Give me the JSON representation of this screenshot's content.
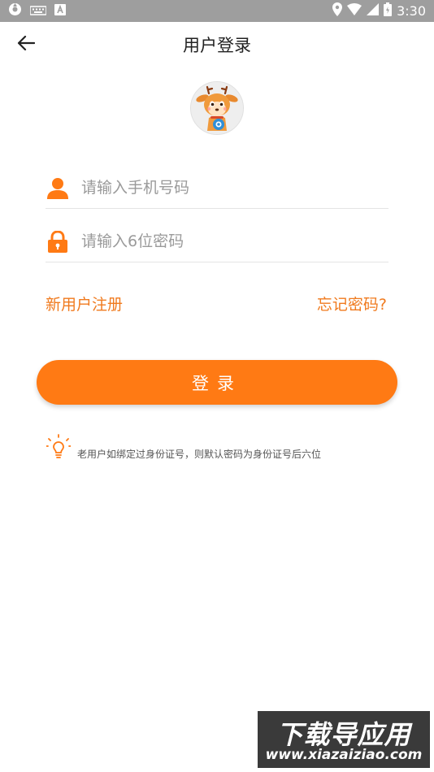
{
  "status_bar": {
    "time": "3:30",
    "icons": [
      "sync-icon",
      "keyboard-icon",
      "text-a-icon",
      "location-icon",
      "wifi-icon",
      "signal-icon",
      "battery-icon"
    ]
  },
  "header": {
    "back_icon": "arrow-left-icon",
    "title": "用户登录"
  },
  "form": {
    "phone_placeholder": "请输入手机号码",
    "phone_value": "",
    "phone_icon": "user-icon",
    "password_placeholder": "请输入6位密码",
    "password_value": "",
    "password_icon": "lock-icon"
  },
  "links": {
    "register": "新用户注册",
    "forgot": "忘记密码?"
  },
  "login_button": "登录",
  "tip": {
    "icon": "lightbulb-icon",
    "text": "老用户如绑定过身份证号，则默认密码为身份证号后六位"
  },
  "watermark": {
    "line1": "下载导应用",
    "line2": "www.xiazaiziao.com"
  },
  "colors": {
    "accent": "#ff7a14",
    "link": "#f07a1e",
    "status_bar": "#9e9e9e"
  }
}
